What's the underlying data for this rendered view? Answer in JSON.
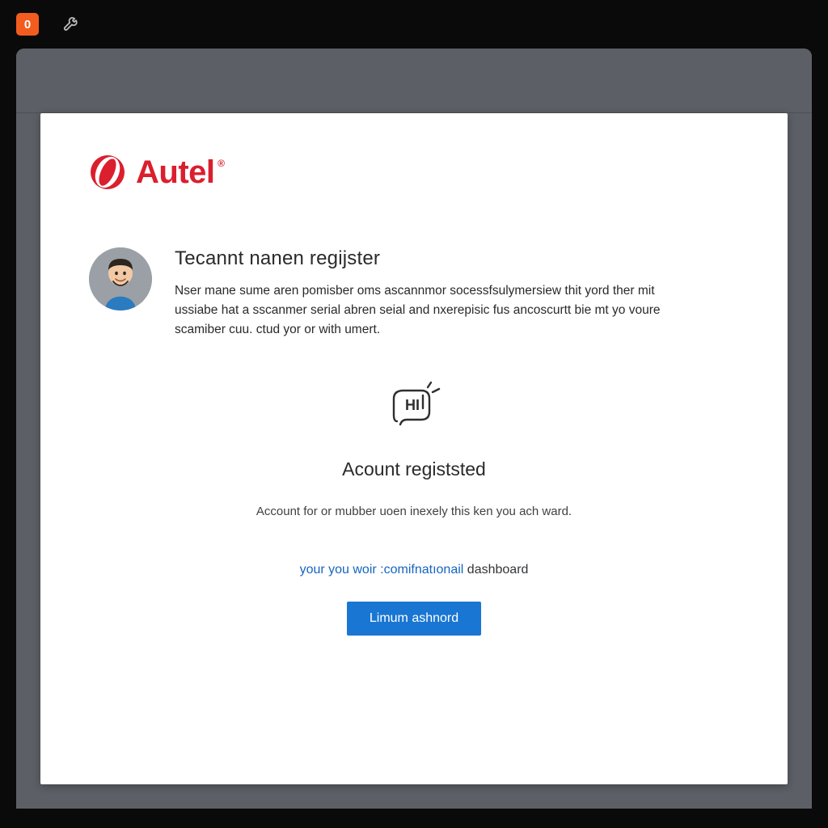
{
  "topbar": {
    "badge_count": "0"
  },
  "brand": {
    "name": "Autel",
    "reg_mark": "®"
  },
  "intro": {
    "heading": "Tecannt nanen regijster",
    "body": "Nser mane sume aren pomisber oms ascannmor socessfsulymersiew thit yord ther mit ussiabe hat a sscanmer serial abren seial and nxerepisic fus ancoscurtt bie mt yo voure scamiber cuu. ctud yor or with umert."
  },
  "status": {
    "title": "Acount registsted",
    "body": "Account for or mubber uoen inexely this ken you ach ward."
  },
  "link_line": {
    "part1": "your you woir",
    "part2": ":comifnatıonail",
    "part3": "dashboard"
  },
  "button": {
    "label": "Limum ashnord"
  }
}
